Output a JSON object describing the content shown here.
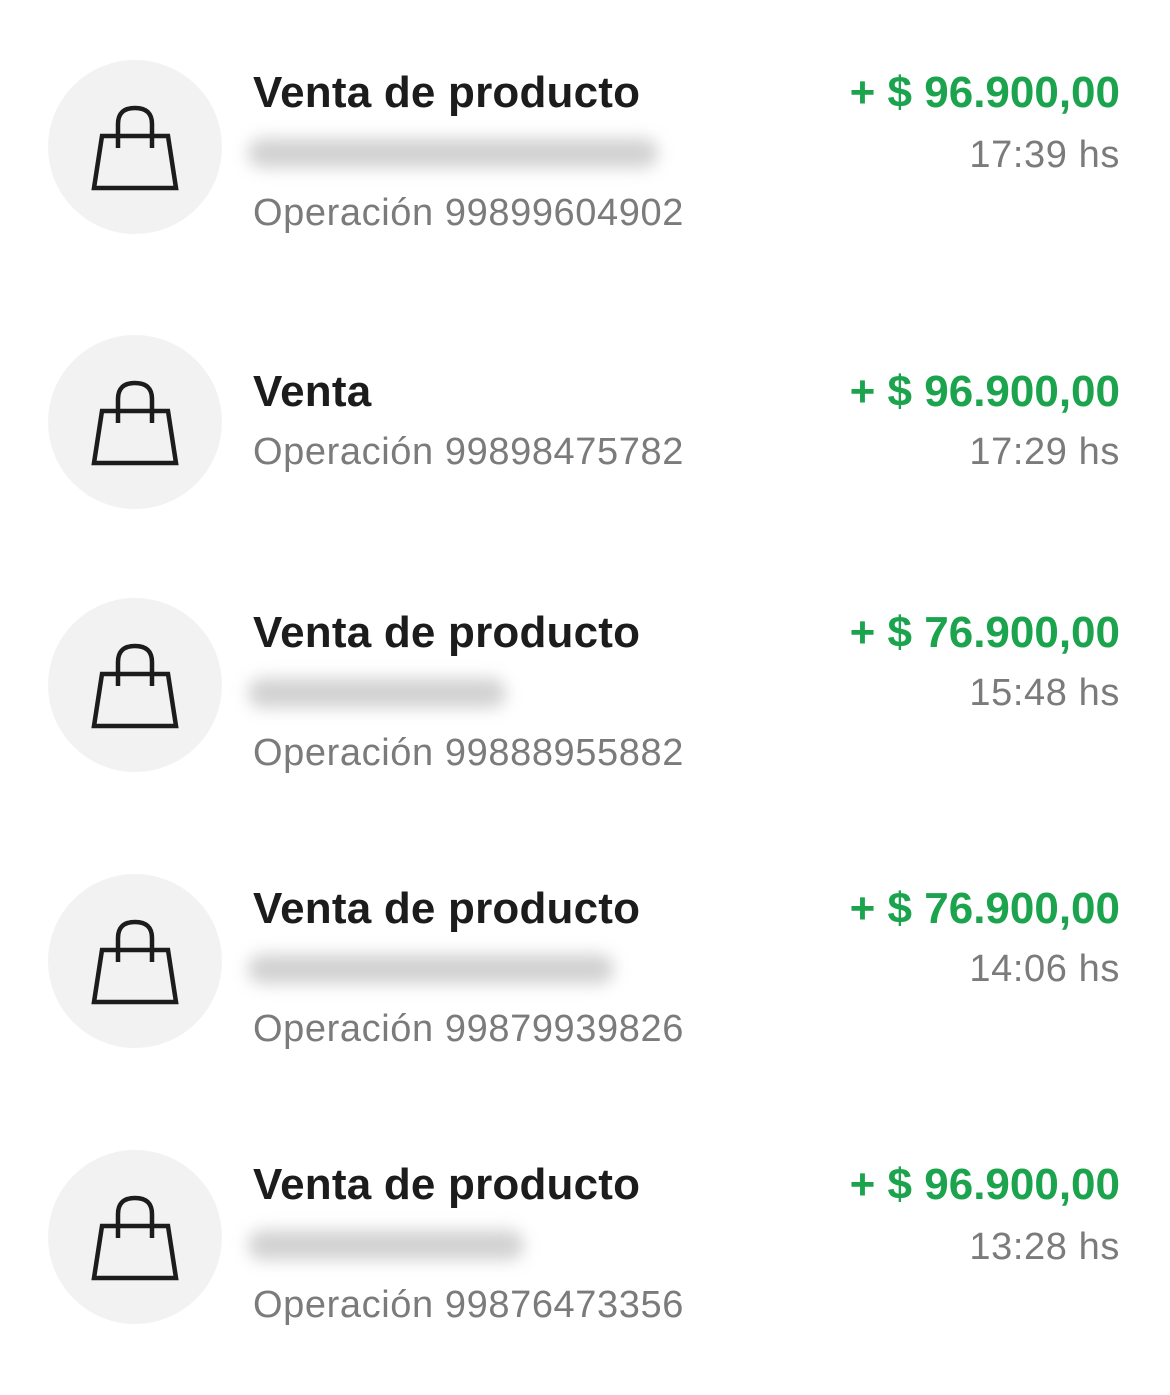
{
  "icons": {
    "transaction_icon": "shopping-bag-icon"
  },
  "colors": {
    "amount_positive": "#1ca34d",
    "title_text": "#1c1c1c",
    "secondary_text": "#7b7b7b",
    "avatar_background": "#f2f2f2"
  },
  "transactions": [
    {
      "title": "Venta de producto",
      "counterparty_redacted": true,
      "operation": "Operación 99899604902",
      "amount": "+ $ 96.900,00",
      "time": "17:39 hs"
    },
    {
      "title": "Venta",
      "counterparty_redacted": false,
      "operation": "Operación 99898475782",
      "amount": "+ $ 96.900,00",
      "time": "17:29 hs"
    },
    {
      "title": "Venta de producto",
      "counterparty_redacted": true,
      "operation": "Operación 99888955882",
      "amount": "+ $ 76.900,00",
      "time": "15:48 hs"
    },
    {
      "title": "Venta de producto",
      "counterparty_redacted": true,
      "operation": "Operación 99879939826",
      "amount": "+ $ 76.900,00",
      "time": "14:06 hs"
    },
    {
      "title": "Venta de producto",
      "counterparty_redacted": true,
      "operation": "Operación 99876473356",
      "amount": "+ $ 96.900,00",
      "time": "13:28 hs"
    }
  ]
}
